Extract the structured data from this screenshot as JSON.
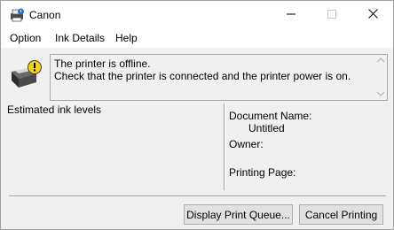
{
  "window": {
    "title": "Canon",
    "icons": {
      "app": "printer-app-icon",
      "minimize": "minimize-icon",
      "maximize": "maximize-icon",
      "close": "close-icon"
    }
  },
  "menu": {
    "items": [
      "Option",
      "Ink Details",
      "Help"
    ]
  },
  "status": {
    "icon": "printer-warning-icon",
    "message_line1": "The printer is offline.",
    "message_line2": "Check that the printer is connected and the printer power is on."
  },
  "ink": {
    "label": "Estimated ink levels"
  },
  "job": {
    "document_name_label": "Document Name:",
    "document_name_value": "Untitled",
    "owner_label": "Owner:",
    "printing_page_label": "Printing Page:"
  },
  "buttons": {
    "display_queue": "Display Print Queue...",
    "cancel_printing": "Cancel Printing"
  }
}
